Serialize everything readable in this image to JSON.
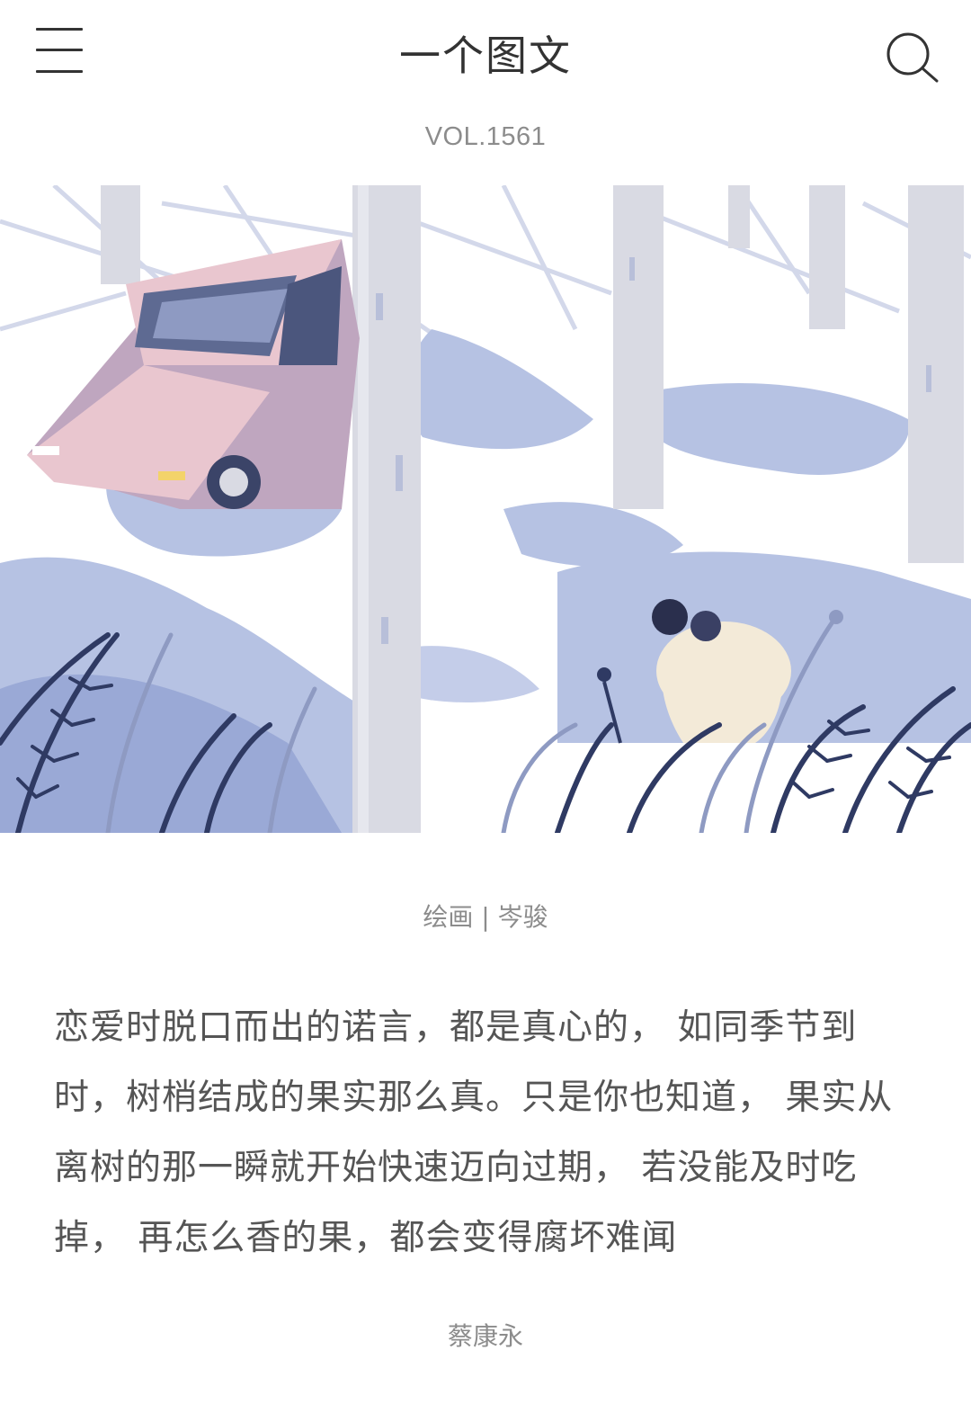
{
  "header": {
    "title": "一个图文",
    "menu_icon": "hamburger-menu-icon",
    "search_icon": "search-icon"
  },
  "volume": "VOL.1561",
  "illustration": {
    "palette": {
      "snow": "#ffffff",
      "shadow": "#b6c2e3",
      "deep_shadow": "#9aa9d6",
      "tree": "#d9dae3",
      "car_body": "#e9c6cf",
      "car_side": "#bfa6bf",
      "fern": "#2f3a63",
      "figures": "#f3ead8"
    }
  },
  "credit": {
    "label": "绘画",
    "separator": "|",
    "artist": "岑骏"
  },
  "quote": {
    "text": "恋爱时脱口而出的诺言，都是真心的， 如同季节到时，树梢结成的果实那么真。只是你也知道， 果实从离树的那一瞬就开始快速迈向过期， 若没能及时吃掉， 再怎么香的果，都会变得腐坏难闻"
  },
  "author": "蔡康永"
}
